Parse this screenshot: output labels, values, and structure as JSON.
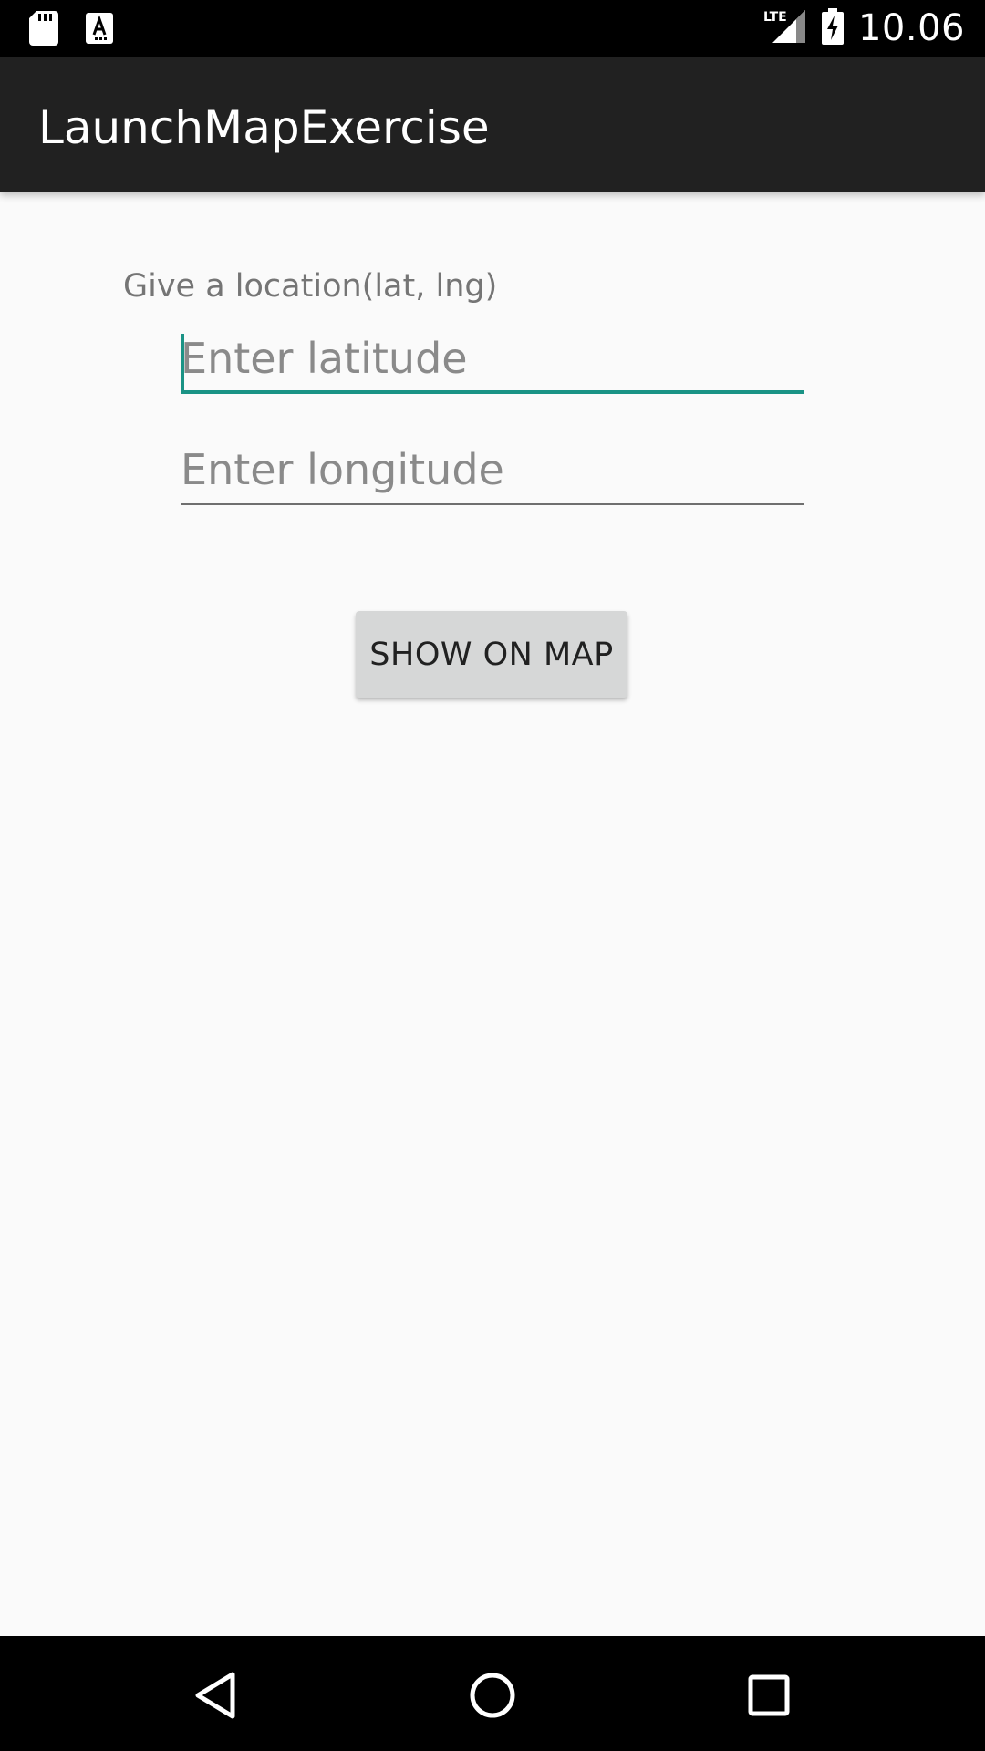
{
  "status_bar": {
    "time": "10.06",
    "network_label": "LTE",
    "icons": [
      "sd-card-icon",
      "app-notification-icon",
      "lte-signal-icon",
      "battery-charging-icon"
    ]
  },
  "app_bar": {
    "title": "LaunchMapExercise"
  },
  "form": {
    "prompt": "Give a location(lat, lng)",
    "latitude": {
      "placeholder": "Enter latitude",
      "value": ""
    },
    "longitude": {
      "placeholder": "Enter longitude",
      "value": ""
    },
    "submit_label": "SHOW ON MAP"
  },
  "nav_bar": {
    "icons": [
      "back-icon",
      "home-icon",
      "recents-icon"
    ]
  },
  "colors": {
    "status_bar": "#000000",
    "app_bar": "#212121",
    "background": "#fafafa",
    "accent": "#1a9385",
    "button": "#d6d7d7"
  }
}
